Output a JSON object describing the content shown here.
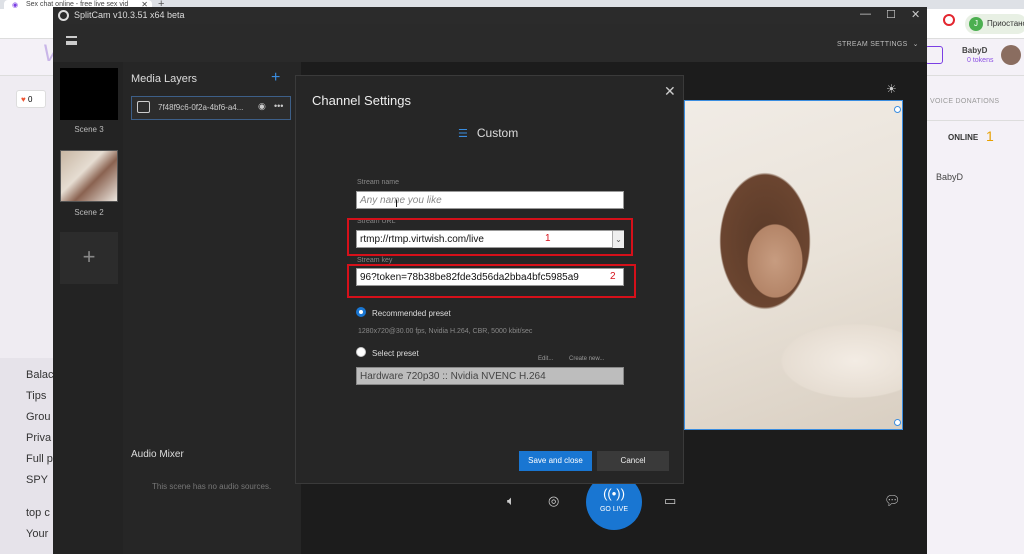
{
  "browser": {
    "tab_title": "Sex chat online - free live sex vid",
    "tab_close": "✕",
    "new_tab": "+",
    "profile_initial": "J",
    "profile_label": "Приостано"
  },
  "site": {
    "likes": "0",
    "username": "BabyD",
    "tokens": "0 tokens",
    "side_links": [
      "Balac",
      "Tips",
      "Grou",
      "Priva",
      "Full p",
      "SPY",
      "top c",
      "Your"
    ],
    "voice_donations": "VOICE DONATIONS",
    "online_label": "ONLINE",
    "online_count": "1",
    "online_user": "BabyD"
  },
  "splitcam": {
    "title": "SplitCam v10.3.51 x64 beta",
    "stream_settings": "STREAM SETTINGS",
    "scenes": [
      {
        "label": "Scene 3"
      },
      {
        "label": "Scene 2"
      }
    ],
    "add_scene": "+",
    "media_layers_title": "Media Layers",
    "layer_name": "7f48f9c6-0f2a-4bf6-a4...",
    "audio_mixer_title": "Audio Mixer",
    "audio_empty": "This scene has no audio sources.",
    "go_live": "GO LIVE"
  },
  "modal": {
    "title": "Channel Settings",
    "close": "✕",
    "preset_name": "Custom",
    "stream_name_label": "Stream name",
    "stream_name_placeholder": "Any name you like",
    "stream_url_label": "Stream URL",
    "stream_url_value": "rtmp://rtmp.virtwish.com/live",
    "stream_key_label": "Stream key",
    "stream_key_value": "96?token=78b38be82fde3d56da2bba4bfc5985a9",
    "annotation_1": "1",
    "annotation_2": "2",
    "recommended_label": "Recommended preset",
    "recommended_desc": "1280x720@30.00 fps, Nvidia H.264, CBR, 5000 kbit/sec",
    "select_label": "Select preset",
    "edit_link": "Edit...",
    "create_link": "Create new...",
    "preset_value": "Hardware 720p30 :: Nvidia NVENC H.264",
    "save_label": "Save and close",
    "cancel_label": "Cancel"
  },
  "colors": {
    "accent": "#1976d2",
    "annotation_red": "#d6101a",
    "site_purple": "#7b3fe4"
  }
}
